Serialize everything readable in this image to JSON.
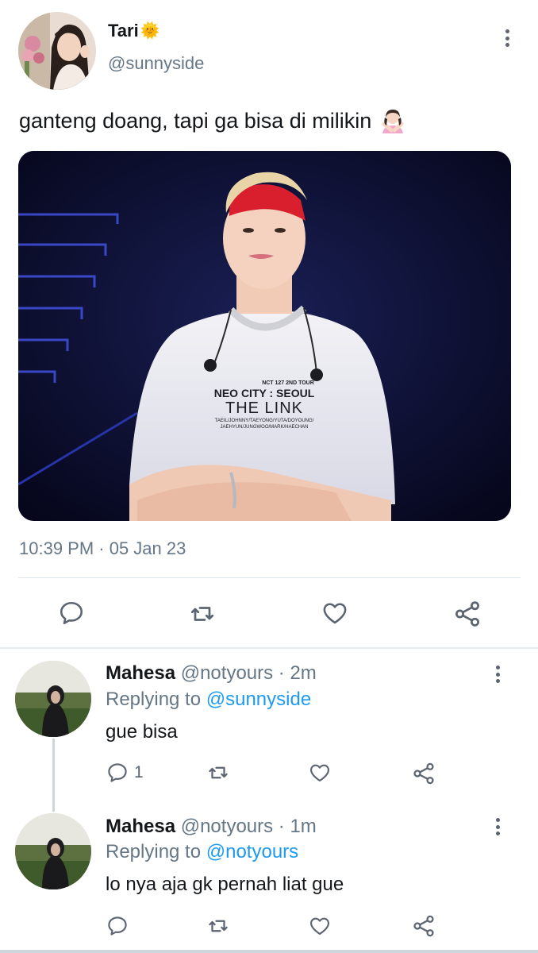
{
  "tweet": {
    "author_name": "Tari",
    "author_emoji": "🌞",
    "handle": "@sunnyside",
    "text": "ganteng doang, tapi ga bisa di milikin",
    "text_emoji": "🙅🏻‍♀️",
    "timestamp": "10:39 PM · 05 Jan 23"
  },
  "replies": [
    {
      "name": "Mahesa",
      "meta": "@notyours · 2m",
      "replying_prefix": "Replying to ",
      "replying_to": "@sunnyside",
      "text": "gue bisa",
      "reply_count": "1"
    },
    {
      "name": "Mahesa",
      "meta": "@notyours · 1m",
      "replying_prefix": "Replying to ",
      "replying_to": "@notyours",
      "text": "lo nya aja gk pernah liat gue",
      "reply_count": ""
    }
  ],
  "media": {
    "shirt_line1": "NCT 127 2ND TOUR",
    "shirt_line2": "NEO CITY : SEOUL",
    "shirt_line3": "THE LINK",
    "shirt_line4": "TAEIL/JOHNNY/TAEYONG/YUTA/DOYOUNG/",
    "shirt_line5": "JAEHYUN/JUNGWOO/MARK/HAECHAN"
  },
  "icons": {
    "reply": "reply-icon",
    "retweet": "retweet-icon",
    "like": "heart-icon",
    "share": "share-icon",
    "more": "more-vertical-icon"
  },
  "colors": {
    "link": "#1d9bf0",
    "muted": "#657786",
    "text": "#14171a"
  }
}
